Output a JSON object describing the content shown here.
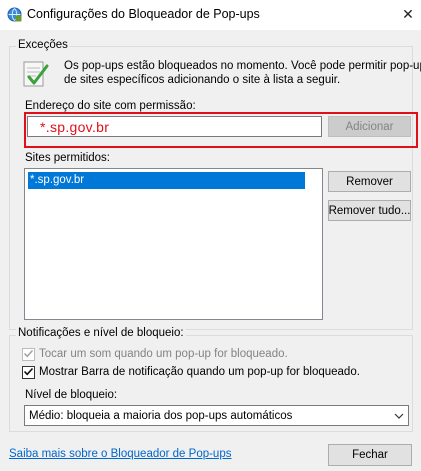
{
  "window": {
    "title": "Configurações do Bloqueador de Pop-ups",
    "close_glyph": "✕"
  },
  "exceptions": {
    "legend": "Exceções",
    "info_line1": "Os pop-ups estão bloqueados no momento. Você pode permitir pop-ups",
    "info_line2": "de sites específicos adicionando o site à lista a seguir.",
    "address_label": "Endereço do site com permissão:",
    "address_value": "*.sp.gov.br",
    "add_button": "Adicionar",
    "allowed_label": "Sites permitidos:",
    "allowed_sites": [
      "*.sp.gov.br"
    ],
    "remove_button": "Remover",
    "remove_all_button": "Remover tudo..."
  },
  "notifications": {
    "legend": "Notificações e nível de bloqueio:",
    "sound_label": "Tocar um som quando um pop-up for bloqueado.",
    "sound_checked": true,
    "sound_enabled": false,
    "bar_label": "Mostrar Barra de notificação quando um pop-up for bloqueado.",
    "bar_checked": true,
    "level_label": "Nível de bloqueio:",
    "level_value": "Médio: bloqueia a maioria dos pop-ups automáticos"
  },
  "footer": {
    "learn_more": "Saiba mais sobre o Bloqueador de Pop-ups",
    "close_button": "Fechar"
  },
  "colors": {
    "highlight_frame": "#e0101a",
    "selection": "#0078d7",
    "link": "#0066cc"
  },
  "icons": [
    "internet-options-icon",
    "close-icon",
    "shield-check-icon",
    "checkmark-icon",
    "chevron-down-icon"
  ]
}
